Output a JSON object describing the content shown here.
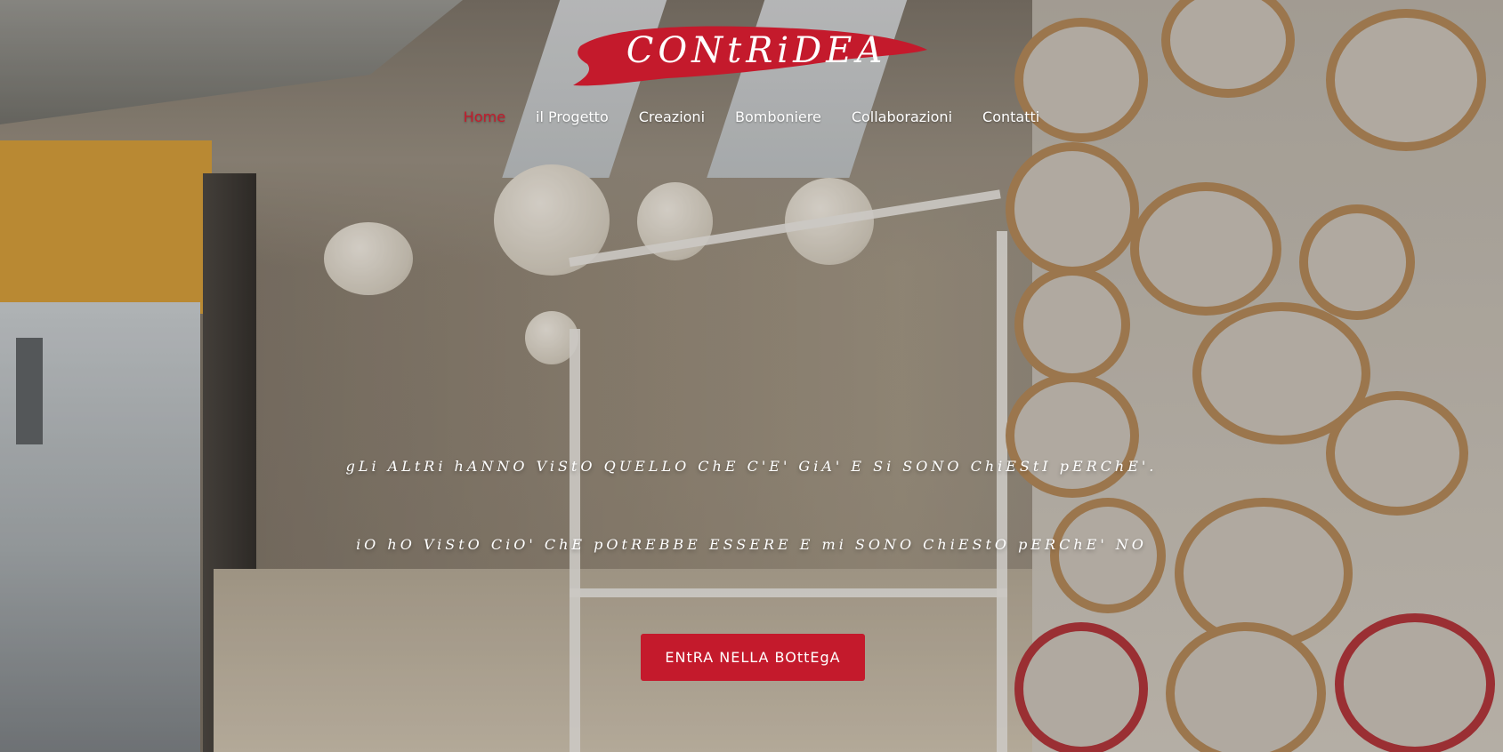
{
  "brand": {
    "logo_text": "CONtRiDEA",
    "accent_color": "#c41a2c"
  },
  "nav": {
    "items": [
      {
        "label": "Home",
        "active": true
      },
      {
        "label": "il Progetto",
        "active": false
      },
      {
        "label": "Creazioni",
        "active": false
      },
      {
        "label": "Bomboniere",
        "active": false
      },
      {
        "label": "Collaborazioni",
        "active": false
      },
      {
        "label": "Contatti",
        "active": false
      }
    ]
  },
  "hero": {
    "tagline_line1": "gLi ALtRi hANNO ViStO QUELLO ChE C'E' GiA' E Si SONO ChiEStI pERChE'.",
    "tagline_line2": "iO hO ViStO CiO' ChE pOtREBBE ESSERE E mi SONO ChiEStO pERChE' NO",
    "cta_label": "ENtRA NELLA BOttEgA"
  }
}
